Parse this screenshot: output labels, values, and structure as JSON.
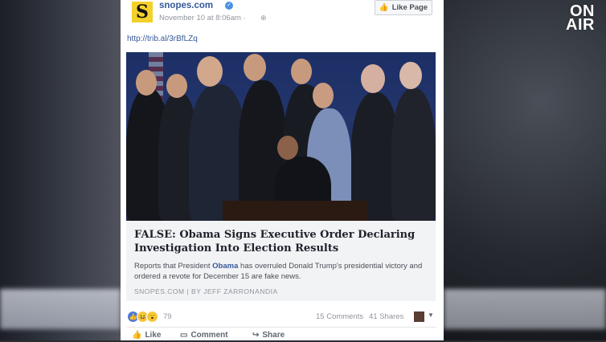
{
  "overlay": {
    "logo_line1": "ON",
    "logo_line2": "AIR"
  },
  "post": {
    "page_name": "snopes.com",
    "timestamp": "November 10 at 8:06am ·",
    "like_page_label": "Like Page",
    "link_text": "http://trib.al/3rBfLZq",
    "logo_letter": "S"
  },
  "article": {
    "headline": "FALSE: Obama Signs Executive Order Declaring Investigation Into Election Results",
    "summary_pre": "Reports that President ",
    "summary_highlight": "Obama",
    "summary_post": " has overruled Donald Trump's presidential victory and ordered a revote for December 15 are fake news.",
    "source": "SNOPES.COM | BY JEFF ZARRONANDIA"
  },
  "engagement": {
    "reaction_count": "79",
    "comments": "15 Comments",
    "shares": "41 Shares"
  },
  "actions": {
    "like": "Like",
    "comment": "Comment",
    "share": "Share"
  },
  "colors": {
    "link": "#365899",
    "page_logo": "#f4d12a",
    "verified": "#4a90e2"
  }
}
